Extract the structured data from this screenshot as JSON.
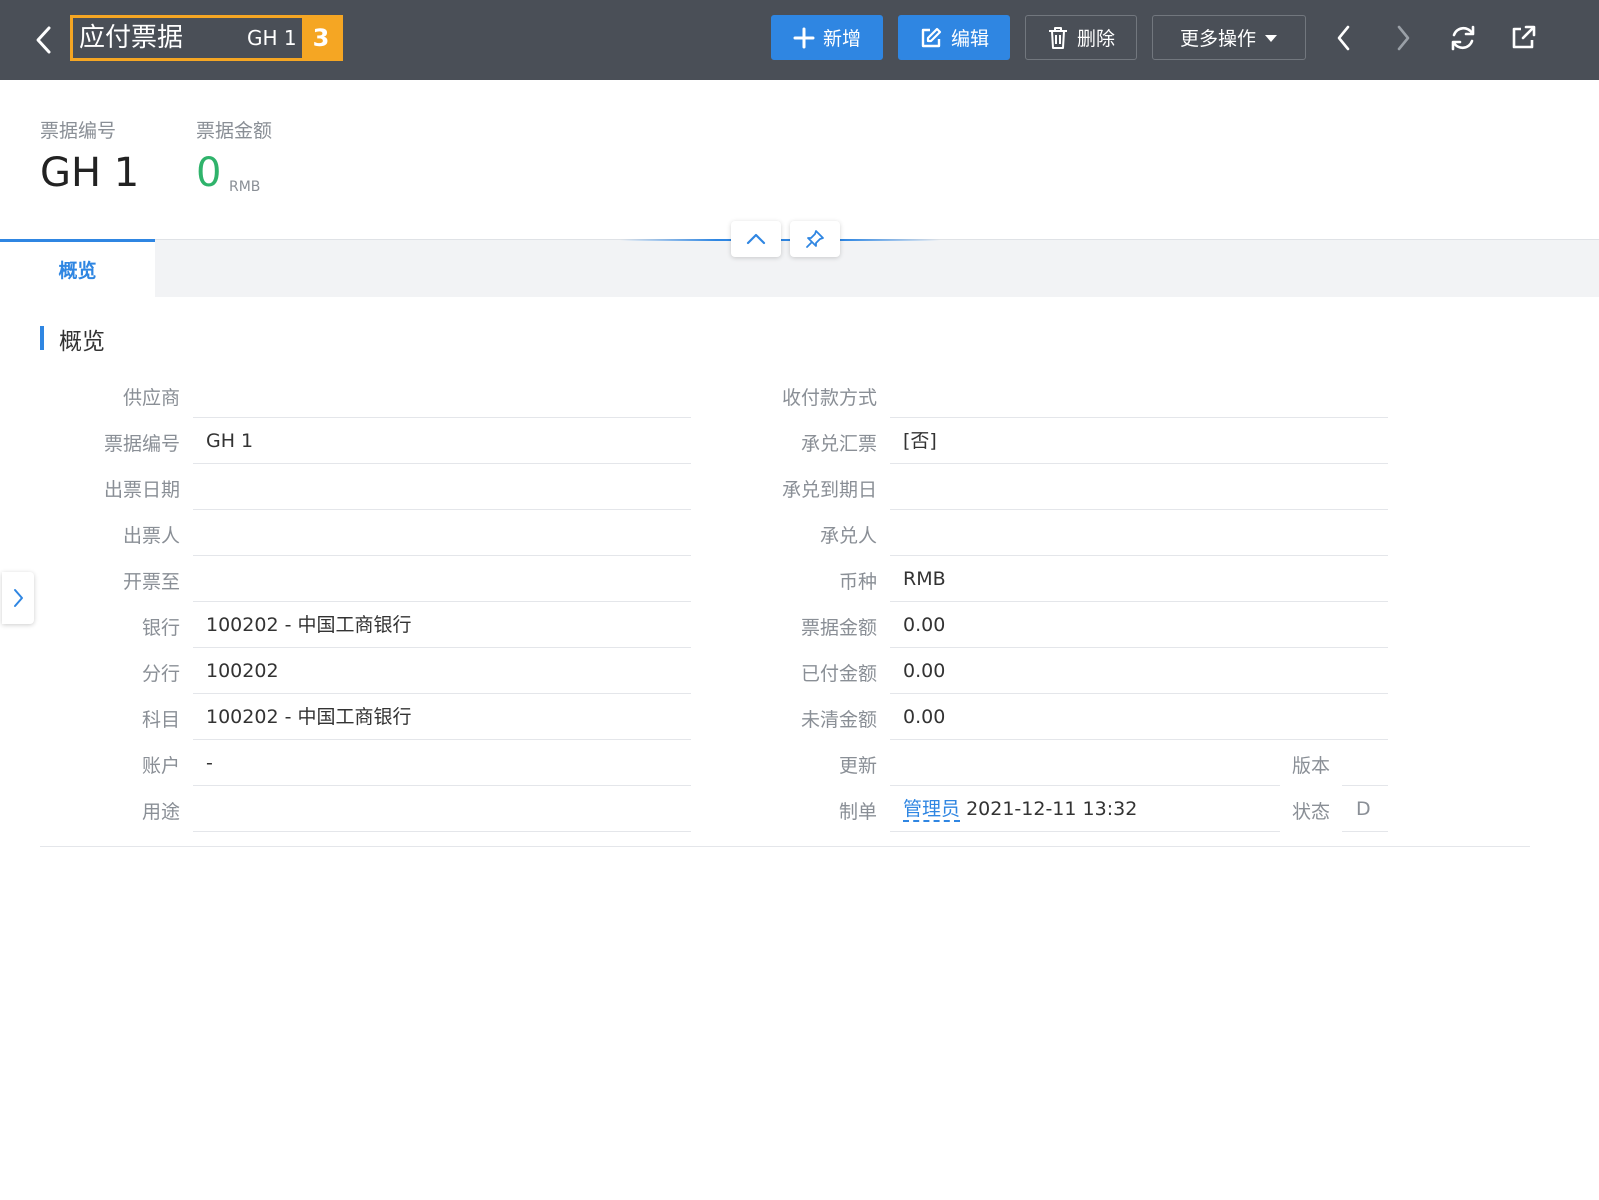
{
  "header": {
    "title": "应付票据",
    "code": "GH 1",
    "badge": "3",
    "buttons": {
      "new": "新增",
      "edit": "编辑",
      "delete": "删除",
      "more": "更多操作"
    }
  },
  "summary": {
    "code_label": "票据编号",
    "code_value": "GH 1",
    "amount_label": "票据金额",
    "amount_value": "0",
    "amount_unit": "RMB"
  },
  "tabs": [
    {
      "label": "概览",
      "active": true
    }
  ],
  "section": {
    "title": "概览"
  },
  "fields_left": [
    {
      "label": "供应商",
      "value": ""
    },
    {
      "label": "票据编号",
      "value": "GH 1"
    },
    {
      "label": "出票日期",
      "value": ""
    },
    {
      "label": "出票人",
      "value": ""
    },
    {
      "label": "开票至",
      "value": ""
    },
    {
      "label": "银行",
      "value": "100202 - 中国工商银行"
    },
    {
      "label": "分行",
      "value": "100202"
    },
    {
      "label": "科目",
      "value": "100202 - 中国工商银行"
    },
    {
      "label": "账户",
      "value": "-"
    },
    {
      "label": "用途",
      "value": ""
    }
  ],
  "fields_right": [
    {
      "label": "收付款方式",
      "value": ""
    },
    {
      "label": "承兑汇票",
      "value": "[否]"
    },
    {
      "label": "承兑到期日",
      "value": ""
    },
    {
      "label": "承兑人",
      "value": ""
    },
    {
      "label": "币种",
      "value": "RMB"
    },
    {
      "label": "票据金额",
      "value": "0.00"
    },
    {
      "label": "已付金额",
      "value": "0.00"
    },
    {
      "label": "未清金额",
      "value": "0.00"
    },
    {
      "label": "更新",
      "value": ""
    },
    {
      "label": "制单",
      "user": "管理员",
      "value": "2021-12-11 13:32"
    }
  ],
  "fields_extra": [
    {
      "label": "版本",
      "value": ""
    },
    {
      "label": "状态",
      "value": "D"
    }
  ],
  "colors": {
    "header_bg": "#4a4f57",
    "primary": "#2f86e2",
    "highlight": "#f5a623",
    "amount": "#2fb36b"
  },
  "icons": {
    "back": "chevron-left-icon",
    "new": "plus-icon",
    "edit": "edit-icon",
    "delete": "trash-icon",
    "more": "caret-down-icon",
    "prev": "chevron-left-icon",
    "next": "chevron-right-icon",
    "refresh": "refresh-icon",
    "share": "external-link-icon",
    "collapse": "chevron-up-icon",
    "pin": "pin-icon",
    "side": "chevron-right-icon"
  }
}
